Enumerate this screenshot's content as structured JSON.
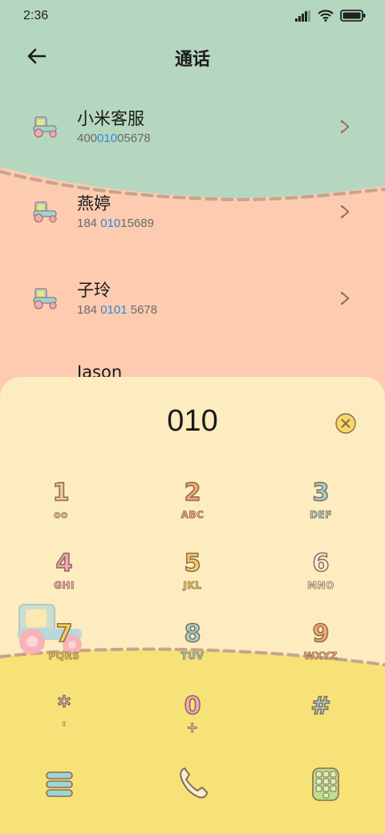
{
  "status_bar": {
    "time": "2:36"
  },
  "header": {
    "title": "通话"
  },
  "contacts": [
    {
      "name": "小米客服",
      "number_pre": "400",
      "number_hl": "010",
      "number_post": "05678"
    },
    {
      "name": "燕婷",
      "number_pre": "184 ",
      "number_hl": "010",
      "number_post": "15689"
    },
    {
      "name": "子玲",
      "number_pre": "184 ",
      "number_hl": "0101",
      "number_post": " 5678"
    },
    {
      "name": "Jason"
    }
  ],
  "dialer": {
    "input": "010",
    "keys": [
      {
        "digit": "1",
        "letters": "oo",
        "color": "#f2c99a"
      },
      {
        "digit": "2",
        "letters": "ABC",
        "color": "#f5a86a"
      },
      {
        "digit": "3",
        "letters": "DEF",
        "color": "#9fd3d6"
      },
      {
        "digit": "4",
        "letters": "GHI",
        "color": "#f3a7b8"
      },
      {
        "digit": "5",
        "letters": "JKL",
        "color": "#f6cf52"
      },
      {
        "digit": "6",
        "letters": "MNO",
        "color": "#f8efd9"
      },
      {
        "digit": "7",
        "letters": "PQRS",
        "color": "#f6cf52"
      },
      {
        "digit": "8",
        "letters": "TUV",
        "color": "#9fd3d6"
      },
      {
        "digit": "9",
        "letters": "WXYZ",
        "color": "#f5a86a"
      },
      {
        "digit": "*",
        "letters": "'",
        "color": "#f8efd9"
      },
      {
        "digit": "0",
        "letters": "+",
        "color": "#f3a7b8"
      },
      {
        "digit": "#",
        "letters": "",
        "color": "#9fd3d6"
      }
    ]
  },
  "colors": {
    "green_bg": "#b6d7bf",
    "peach_bg": "#fccbb0",
    "sheet_bg": "#fcecc0",
    "yellow_bg": "#f7e277",
    "highlight": "#2f87d8"
  }
}
